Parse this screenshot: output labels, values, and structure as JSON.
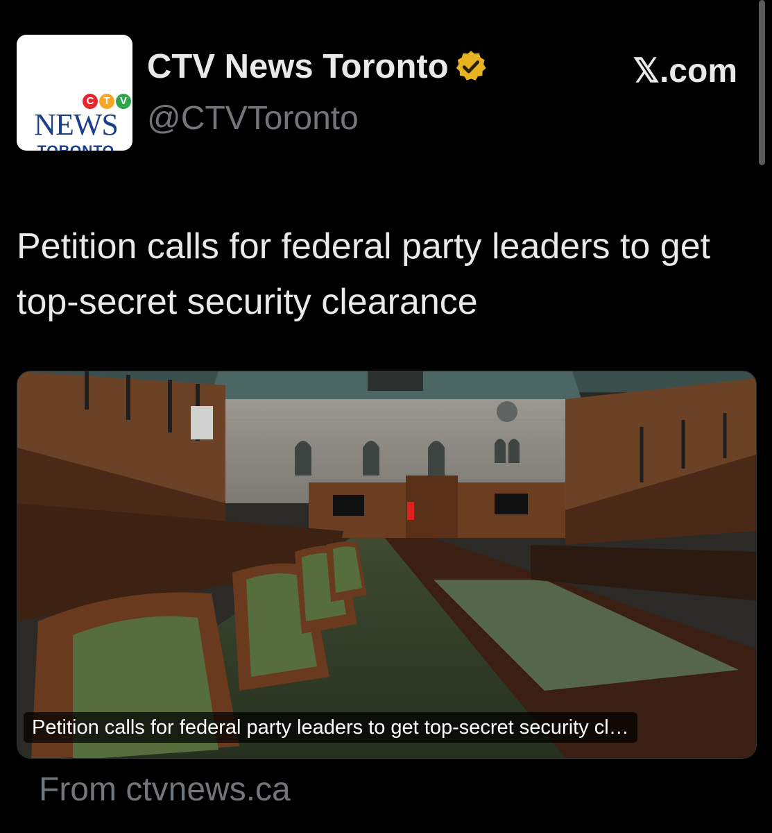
{
  "account": {
    "display_name": "CTV News Toronto",
    "handle": "@CTVToronto",
    "verified_icon": "verified-gold-badge-icon",
    "logo": {
      "network": "CTV",
      "word": "NEWS",
      "city": "TORONTO",
      "colors": [
        "#e4262d",
        "#f5a623",
        "#2ea54b"
      ]
    }
  },
  "source_label": "𝕏.com",
  "tweet": {
    "text": "Petition calls for federal party leaders to get top-secret security clearance"
  },
  "link_card": {
    "image": "house-of-commons-chamber-photo",
    "caption": "Petition calls for federal party leaders to get top-secret security cl…",
    "from_label": "From ctvnews.ca"
  },
  "colors": {
    "background": "#000000",
    "text": "#e7e9ea",
    "muted": "#71767b",
    "verified": "#e8b321"
  }
}
